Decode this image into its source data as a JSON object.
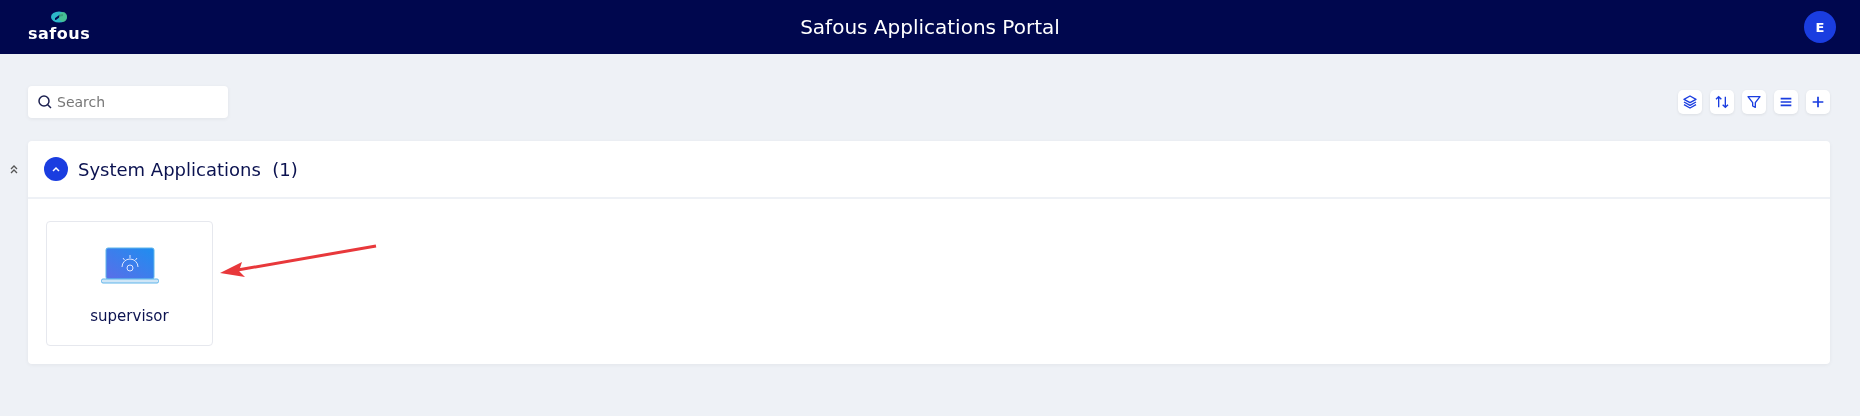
{
  "header": {
    "logo": "safous",
    "title": "Safous Applications Portal",
    "avatar": "E"
  },
  "search": {
    "placeholder": "Search"
  },
  "toolbar": [
    {
      "kind": "layers"
    },
    {
      "kind": "sort"
    },
    {
      "kind": "filter"
    },
    {
      "kind": "list"
    },
    {
      "kind": "add"
    }
  ],
  "sections": [
    {
      "title": "System Applications",
      "count": "(1)",
      "expanded": true,
      "apps": [
        {
          "name": "supervisor"
        }
      ]
    }
  ]
}
